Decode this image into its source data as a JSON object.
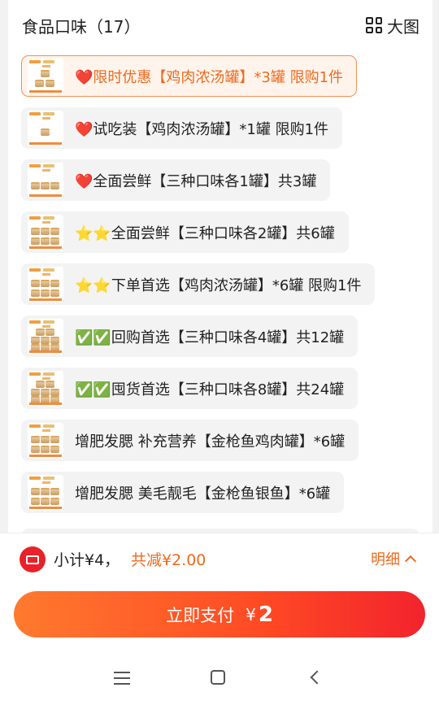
{
  "header": {
    "title": "食品口味（17）",
    "view_toggle_label": "大图",
    "view_toggle_icon": "grid-icon"
  },
  "options": [
    {
      "label": "❤️限时优惠【鸡肉浓汤罐】*3罐 限购1件",
      "selected": true
    },
    {
      "label": "❤️试吃装【鸡肉浓汤罐】*1罐 限购1件",
      "selected": false
    },
    {
      "label": "❤️全面尝鲜【三种口味各1罐】共3罐",
      "selected": false
    },
    {
      "label": "⭐⭐全面尝鲜【三种口味各2罐】共6罐",
      "selected": false
    },
    {
      "label": "⭐⭐下单首选【鸡肉浓汤罐】*6罐 限购1件",
      "selected": false
    },
    {
      "label": "✅✅回购首选【三种口味各4罐】共12罐",
      "selected": false
    },
    {
      "label": "✅✅囤货首选【三种口味各8罐】共24罐",
      "selected": false
    },
    {
      "label": "增肥发腮 补充营养【金枪鱼鸡肉罐】*6罐",
      "selected": false
    },
    {
      "label": "增肥发腮 美毛靓毛【金枪鱼银鱼】*6罐",
      "selected": false
    }
  ],
  "footer": {
    "coupon_icon": "coupon-icon",
    "subtotal": "小计¥4，",
    "discount": "共减¥2.00",
    "details_label": "明细",
    "details_icon": "chevron-up-icon"
  },
  "pay_button": {
    "label": "立即支付",
    "currency": "¥",
    "amount": "2"
  },
  "navbar": {
    "menu_icon": "menu-icon",
    "home_icon": "home-icon",
    "back_icon": "back-icon"
  },
  "colors": {
    "accent": "#ee6a1e",
    "selected_border": "#f39052",
    "selected_bg": "#fff4ec",
    "pay_gradient_start": "#ff7a2e",
    "pay_gradient_end": "#f2232d",
    "coupon_red": "#e8212a"
  }
}
